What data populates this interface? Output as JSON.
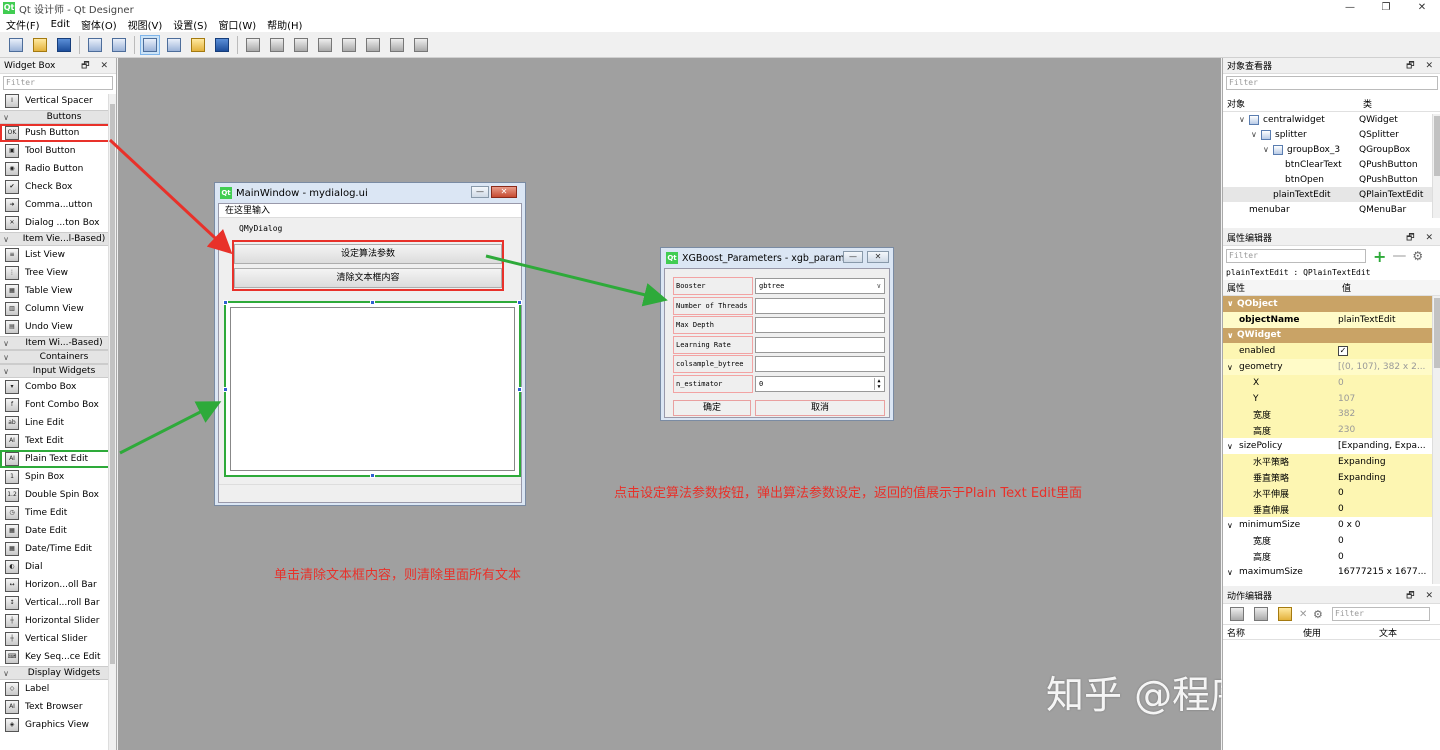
{
  "window": {
    "app_icon": "Qt",
    "title": "Qt 设计师 - Qt Designer",
    "minimize": "—",
    "restore": "❐",
    "close": "✕"
  },
  "menubar": {
    "items": [
      "文件(F)",
      "Edit",
      "窗体(O)",
      "视图(V)",
      "设置(S)",
      "窗口(W)",
      "帮助(H)"
    ]
  },
  "toolbar": {
    "icons": [
      "new-form-icon",
      "open-icon",
      "save-icon",
      "send-back-icon",
      "bring-front-icon",
      "edit-widgets-icon",
      "edit-signals-icon",
      "edit-buddies-icon",
      "edit-tab-order-icon",
      "layout-horizontal-icon",
      "layout-vertical-icon",
      "layout-h-splitter-icon",
      "layout-v-splitter-icon",
      "layout-grid-icon",
      "layout-form-icon",
      "break-layout-icon",
      "adjust-size-icon"
    ]
  },
  "widget_box": {
    "title": "Widget Box",
    "dock_buttons": "🗗 ✕",
    "filter_placeholder": "Filter",
    "sections": [
      {
        "type": "item",
        "label": "Vertical Spacer",
        "icon": "I"
      },
      {
        "type": "cat",
        "label": "Buttons"
      },
      {
        "type": "item",
        "label": "Push Button",
        "icon": "OK",
        "highlight": "red"
      },
      {
        "type": "item",
        "label": "Tool Button",
        "icon": "▣"
      },
      {
        "type": "item",
        "label": "Radio Button",
        "icon": "◉"
      },
      {
        "type": "item",
        "label": "Check Box",
        "icon": "✔"
      },
      {
        "type": "item",
        "label": "Comma...utton",
        "icon": "➜"
      },
      {
        "type": "item",
        "label": "Dialog ...ton Box",
        "icon": "✕"
      },
      {
        "type": "cat",
        "label": "Item Vie...l-Based)"
      },
      {
        "type": "item",
        "label": "List View",
        "icon": "≡"
      },
      {
        "type": "item",
        "label": "Tree View",
        "icon": "⋮"
      },
      {
        "type": "item",
        "label": "Table View",
        "icon": "▦"
      },
      {
        "type": "item",
        "label": "Column View",
        "icon": "▥"
      },
      {
        "type": "item",
        "label": "Undo View",
        "icon": "▤"
      },
      {
        "type": "cat",
        "label": "Item Wi...-Based)"
      },
      {
        "type": "cat",
        "label": "Containers"
      },
      {
        "type": "cat",
        "label": "Input Widgets"
      },
      {
        "type": "item",
        "label": "Combo Box",
        "icon": "▾"
      },
      {
        "type": "item",
        "label": "Font Combo Box",
        "icon": "f"
      },
      {
        "type": "item",
        "label": "Line Edit",
        "icon": "ab"
      },
      {
        "type": "item",
        "label": "Text Edit",
        "icon": "AI"
      },
      {
        "type": "item",
        "label": "Plain Text Edit",
        "icon": "AI",
        "highlight": "green"
      },
      {
        "type": "item",
        "label": "Spin Box",
        "icon": "1"
      },
      {
        "type": "item",
        "label": "Double Spin Box",
        "icon": "1.2"
      },
      {
        "type": "item",
        "label": "Time Edit",
        "icon": "◷"
      },
      {
        "type": "item",
        "label": "Date Edit",
        "icon": "▦"
      },
      {
        "type": "item",
        "label": "Date/Time Edit",
        "icon": "▦"
      },
      {
        "type": "item",
        "label": "Dial",
        "icon": "◐"
      },
      {
        "type": "item",
        "label": "Horizon...oll Bar",
        "icon": "↔"
      },
      {
        "type": "item",
        "label": "Vertical...roll Bar",
        "icon": "↕"
      },
      {
        "type": "item",
        "label": "Horizontal Slider",
        "icon": "┼"
      },
      {
        "type": "item",
        "label": "Vertical Slider",
        "icon": "┼"
      },
      {
        "type": "item",
        "label": "Key Seq...ce Edit",
        "icon": "⌨"
      },
      {
        "type": "cat",
        "label": "Display Widgets"
      },
      {
        "type": "item",
        "label": "Label",
        "icon": "◇"
      },
      {
        "type": "item",
        "label": "Text Browser",
        "icon": "AI"
      },
      {
        "type": "item",
        "label": "Graphics View",
        "icon": "◈"
      }
    ]
  },
  "main_form": {
    "title": "MainWindow - mydialog.ui",
    "menu": "在这里输入",
    "dialog_label": "QMyDialog",
    "btn_set_params": "设定算法参数",
    "btn_clear_text": "清除文本框内容",
    "min": "—",
    "max": "▭",
    "close": "✕"
  },
  "xgb_dialog": {
    "title": "XGBoost_Parameters - xgb_param...",
    "min": "—",
    "close": "✕",
    "rows": [
      {
        "label": "Booster",
        "value": "gbtree",
        "kind": "combo"
      },
      {
        "label": "Number of Threads",
        "value": "",
        "kind": "line"
      },
      {
        "label": "Max Depth",
        "value": "",
        "kind": "line"
      },
      {
        "label": "Learning Rate",
        "value": "",
        "kind": "line"
      },
      {
        "label": "colsample_bytree",
        "value": "",
        "kind": "line"
      },
      {
        "label": "n_estimator",
        "value": "0",
        "kind": "spin"
      }
    ],
    "ok": "确定",
    "cancel": "取消"
  },
  "annotations": {
    "right_note": "点击设定算法参数按钮，弹出算法参数设定，返回的值展示于Plain Text Edit里面",
    "bottom_note": "单击清除文本框内容，则清除里面所有文本",
    "watermark": "知乎 @程序员随笔"
  },
  "object_inspector": {
    "title": "对象查看器",
    "dock_buttons": "🗗 ✕",
    "filter_placeholder": "Filter",
    "col_object": "对象",
    "col_class": "类",
    "rows": [
      {
        "name": "centralwidget",
        "cls": "QWidget",
        "indent": 1,
        "expand": "v"
      },
      {
        "name": "splitter",
        "cls": "QSplitter",
        "indent": 2,
        "expand": "v"
      },
      {
        "name": "groupBox_3",
        "cls": "QGroupBox",
        "indent": 3,
        "expand": "v"
      },
      {
        "name": "btnClearText",
        "cls": "QPushButton",
        "indent": 4,
        "expand": ""
      },
      {
        "name": "btnOpen",
        "cls": "QPushButton",
        "indent": 4,
        "expand": ""
      },
      {
        "name": "plainTextEdit",
        "cls": "QPlainTextEdit",
        "indent": 3,
        "expand": "",
        "selected": true
      },
      {
        "name": "menubar",
        "cls": "QMenuBar",
        "indent": 1,
        "expand": ""
      }
    ]
  },
  "property_editor": {
    "title": "属性编辑器",
    "dock_buttons": "🗗 ✕",
    "filter_placeholder": "Filter",
    "object_line": "plainTextEdit : QPlainTextEdit",
    "col_prop": "属性",
    "col_value": "值",
    "rows": [
      {
        "name": "QObject",
        "value": "",
        "kind": "group"
      },
      {
        "name": "objectName",
        "value": "plainTextEdit",
        "kind": "yel",
        "bold": true
      },
      {
        "name": "QWidget",
        "value": "",
        "kind": "group"
      },
      {
        "name": "enabled",
        "value": "✓",
        "kind": "check"
      },
      {
        "name": "geometry",
        "value": "[(0, 107), 382 x 2...",
        "kind": "yel",
        "expand": "v",
        "dim": true
      },
      {
        "name": "X",
        "value": "0",
        "kind": "yel2 sub",
        "dim": true
      },
      {
        "name": "Y",
        "value": "107",
        "kind": "yel2 sub",
        "dim": true
      },
      {
        "name": "宽度",
        "value": "382",
        "kind": "yel2 sub",
        "dim": true
      },
      {
        "name": "高度",
        "value": "230",
        "kind": "yel2 sub",
        "dim": true
      },
      {
        "name": "sizePolicy",
        "value": "[Expanding, Expa...",
        "kind": "plain",
        "expand": "v"
      },
      {
        "name": "水平策略",
        "value": "Expanding",
        "kind": "yel2 sub"
      },
      {
        "name": "垂直策略",
        "value": "Expanding",
        "kind": "yel2 sub"
      },
      {
        "name": "水平伸展",
        "value": "0",
        "kind": "yel2 sub"
      },
      {
        "name": "垂直伸展",
        "value": "0",
        "kind": "yel2 sub"
      },
      {
        "name": "minimumSize",
        "value": "0 x 0",
        "kind": "plain",
        "expand": "v"
      },
      {
        "name": "宽度",
        "value": "0",
        "kind": "plain sub"
      },
      {
        "name": "高度",
        "value": "0",
        "kind": "plain sub"
      },
      {
        "name": "maximumSize",
        "value": "16777215 x 1677...",
        "kind": "plain",
        "expand": "v"
      }
    ]
  },
  "action_editor": {
    "title": "动作编辑器",
    "dock_buttons": "🗗 ✕",
    "filter_placeholder": "Filter",
    "col_name": "名称",
    "col_used": "使用",
    "col_text": "文本"
  }
}
